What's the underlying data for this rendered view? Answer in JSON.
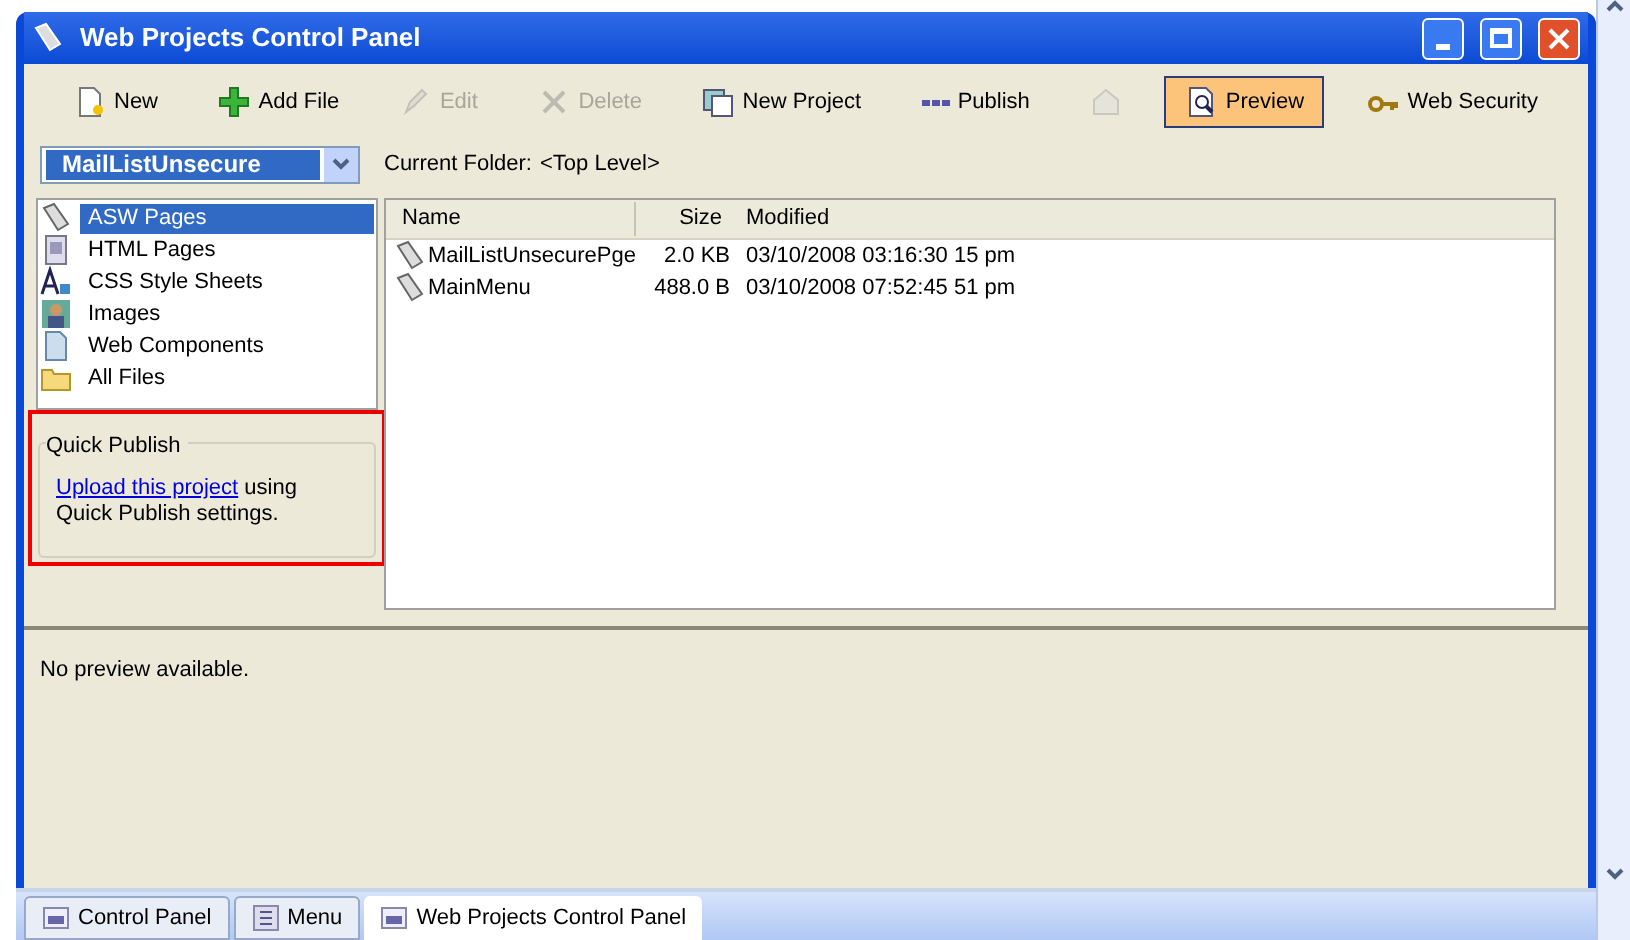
{
  "window": {
    "title": "Web Projects Control Panel"
  },
  "toolbar": [
    {
      "label": "New",
      "disabled": false,
      "selected": false,
      "kind": "new"
    },
    {
      "label": "Add File",
      "disabled": false,
      "selected": false,
      "kind": "add"
    },
    {
      "label": "Edit",
      "disabled": true,
      "selected": false,
      "kind": "edit"
    },
    {
      "label": "Delete",
      "disabled": true,
      "selected": false,
      "kind": "delete"
    },
    {
      "label": "New Project",
      "disabled": false,
      "selected": false,
      "kind": "project"
    },
    {
      "label": "Publish",
      "disabled": false,
      "selected": false,
      "kind": "publish"
    },
    {
      "disabled": true,
      "selected": false,
      "kind": "upload"
    },
    {
      "label": "Preview",
      "disabled": false,
      "selected": true,
      "kind": "preview"
    },
    {
      "label": "Web Security",
      "disabled": false,
      "selected": false,
      "kind": "security"
    }
  ],
  "project_select": {
    "value": "MailListUnsecure"
  },
  "current_folder": {
    "label": "Current Folder:",
    "value": "<Top Level>"
  },
  "categories": [
    {
      "label": "ASW Pages",
      "selected": true,
      "kind": "asw"
    },
    {
      "label": "HTML Pages",
      "selected": false,
      "kind": "html"
    },
    {
      "label": "CSS Style Sheets",
      "selected": false,
      "kind": "css"
    },
    {
      "label": "Images",
      "selected": false,
      "kind": "image"
    },
    {
      "label": "Web Components",
      "selected": false,
      "kind": "component"
    },
    {
      "label": "All Files",
      "selected": false,
      "kind": "folder"
    }
  ],
  "quick_publish": {
    "title": "Quick Publish",
    "link": "Upload this project",
    "text": " using Quick Publish settings."
  },
  "table": {
    "columns": [
      "Name",
      "Size",
      "Modified"
    ],
    "rows": [
      [
        "MailListUnsecurePge",
        "2.0 KB",
        "03/10/2008 03:16:30 15 pm"
      ],
      [
        "MainMenu",
        "488.0 B",
        "03/10/2008 07:52:45 51 pm"
      ]
    ]
  },
  "preview": {
    "text": "No preview available."
  },
  "tabs": [
    {
      "label": "Control Panel",
      "selected": false,
      "kind": "panel"
    },
    {
      "label": "Menu",
      "selected": false,
      "kind": "menu"
    },
    {
      "label": "Web Projects Control Panel",
      "selected": true,
      "kind": "panel"
    }
  ]
}
